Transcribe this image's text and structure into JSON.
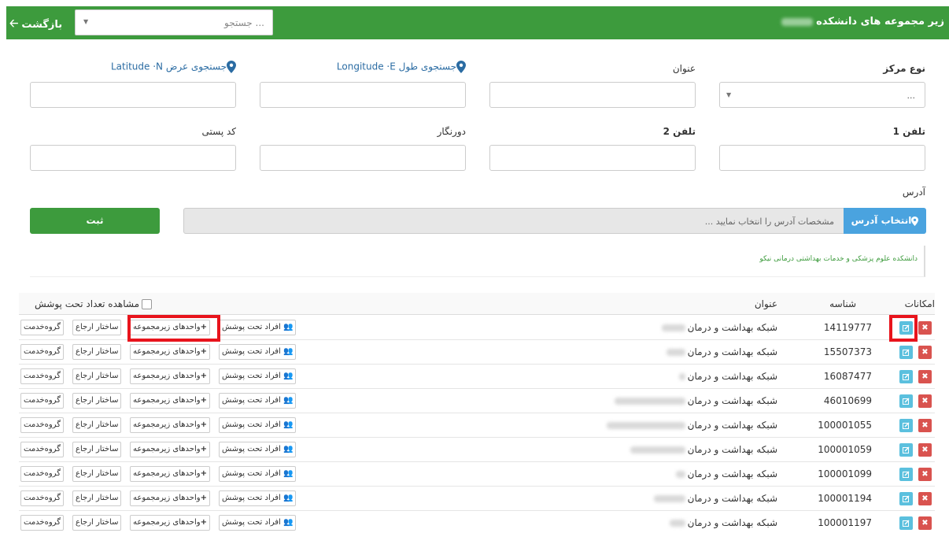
{
  "header": {
    "title": "زیر مجموعه های دانشکده",
    "back_label": "بازگشت",
    "search_placeholder": "جستجو ..."
  },
  "form": {
    "center_type_label": "نوع مرکز",
    "center_type_value": "...",
    "title_label": "عنوان",
    "longitude_label": "جستجوی طول Longitude ·E",
    "latitude_label": "جستجوی عرض Latitude ·N",
    "phone1_label": "تلفن 1",
    "phone2_label": "تلفن 2",
    "fax_label": "دورنگار",
    "postal_label": "کد پستی",
    "address_label": "آدرس",
    "address_button": "انتخاب آدرس",
    "address_placeholder": "مشخصات آدرس را انتخاب نمایید ...",
    "submit_label": "ثبت",
    "university_text": "دانشکده علوم پزشکی و خدمات بهداشتی درمانی نیکو"
  },
  "table": {
    "headers": {
      "actions": "امکانات",
      "code": "شناسه",
      "title": "عنوان",
      "show_count": "مشاهده تعداد تحت پوشش"
    },
    "buttons": {
      "covered": "افراد تحت پوشش",
      "sub_units": "واحدهای زیرمجموعه",
      "referral": "ساختار ارجاع",
      "service_group": "گروه‌خدمت"
    },
    "rows": [
      {
        "code": "14119777",
        "name": "شبکه بهداشت و درمان"
      },
      {
        "code": "15507373",
        "name": "شبکه بهداشت و درمان"
      },
      {
        "code": "16087477",
        "name": "شبکه بهداشت و درمان"
      },
      {
        "code": "46010699",
        "name": "شبکه بهداشت و درمان"
      },
      {
        "code": "100001055",
        "name": "شبکه بهداشت و درمان"
      },
      {
        "code": "100001059",
        "name": "شبکه بهداشت و درمان"
      },
      {
        "code": "100001099",
        "name": "شبکه بهداشت و درمان"
      },
      {
        "code": "100001194",
        "name": "شبکه بهداشت و درمان"
      },
      {
        "code": "100001197",
        "name": "شبکه بهداشت و درمان"
      }
    ]
  },
  "colors": {
    "brand_green": "#3d9b3d",
    "delete_red": "#d9534f",
    "edit_blue": "#5bc0de",
    "highlight_red": "#e8141c"
  }
}
